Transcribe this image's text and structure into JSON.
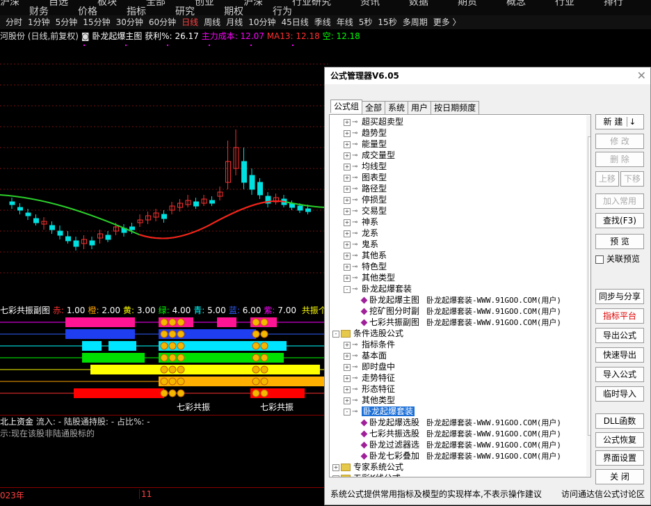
{
  "top_menu": [
    "沪深",
    "自选",
    "板块",
    "全部",
    "创业",
    "沪深",
    "行业研究",
    "资讯",
    "数据",
    "期货",
    "概念",
    "行业",
    "排行",
    "财务",
    "价格",
    "指标",
    "研究",
    "期权",
    "行为"
  ],
  "periods": [
    {
      "label": "分时",
      "active": false
    },
    {
      "label": "1分钟",
      "active": false
    },
    {
      "label": "5分钟",
      "active": false
    },
    {
      "label": "15分钟",
      "active": false
    },
    {
      "label": "30分钟",
      "active": false
    },
    {
      "label": "60分钟",
      "active": false
    },
    {
      "label": "日线",
      "active": true
    },
    {
      "label": "周线",
      "active": false
    },
    {
      "label": "月线",
      "active": false
    },
    {
      "label": "10分钟",
      "active": false
    },
    {
      "label": "45日线",
      "active": false
    },
    {
      "label": "季线",
      "active": false
    },
    {
      "label": "年线",
      "active": false
    },
    {
      "label": "5秒",
      "active": false
    },
    {
      "label": "15秒",
      "active": false
    },
    {
      "label": "多周期",
      "active": false
    },
    {
      "label": "更多 〉",
      "active": false
    }
  ],
  "info_bar": {
    "stock": "河股份 (日线,前复权)",
    "indicator": "卧龙起爆主图",
    "profit_label": "获利%:",
    "profit_value": "26.17",
    "cost_label": "主力成本:",
    "cost_value": "12.07",
    "ma_label": "MA13:",
    "ma_value": "12.18",
    "kong_label": "空:",
    "kong_value": "12.18"
  },
  "sub_chart": {
    "title": "七彩共振副图",
    "params": [
      {
        "name": "赤:",
        "value": "1.00",
        "color": "#ff3030"
      },
      {
        "name": "橙:",
        "value": "2.00",
        "color": "#ffa500"
      },
      {
        "name": "黄:",
        "value": "3.00",
        "color": "#ffff00"
      },
      {
        "name": "绿:",
        "value": "4.00",
        "color": "#00ff00"
      },
      {
        "name": "青:",
        "value": "5.00",
        "color": "#00ffff"
      },
      {
        "name": "蓝:",
        "value": "6.00",
        "color": "#3060ff"
      },
      {
        "name": "紫:",
        "value": "7.00",
        "color": "#ff00ff"
      }
    ],
    "tail": "共振个数",
    "labels": [
      "七彩共振",
      "七彩共振"
    ]
  },
  "north": {
    "prefix": "北上资金",
    "flow_label": "流入:",
    "flow_value": "-",
    "hold_label": "陆股通持股:",
    "hold_value": "-",
    "ratio_label": "占比%:",
    "ratio_value": "-",
    "message": "示:现在该股非陆通股标的"
  },
  "dates": [
    "023年",
    "11"
  ],
  "dialog": {
    "title": "公式管理器V6.05",
    "tabs": [
      "公式组",
      "全部",
      "系统",
      "用户",
      "按日期频度"
    ],
    "tree": [
      {
        "level": 1,
        "type": "key",
        "expander": "+",
        "label": "超买超卖型"
      },
      {
        "level": 1,
        "type": "key",
        "expander": "+",
        "label": "趋势型"
      },
      {
        "level": 1,
        "type": "key",
        "expander": "+",
        "label": "能量型"
      },
      {
        "level": 1,
        "type": "key",
        "expander": "+",
        "label": "成交量型"
      },
      {
        "level": 1,
        "type": "key",
        "expander": "+",
        "label": "均线型"
      },
      {
        "level": 1,
        "type": "key",
        "expander": "+",
        "label": "图表型"
      },
      {
        "level": 1,
        "type": "key",
        "expander": "+",
        "label": "路径型"
      },
      {
        "level": 1,
        "type": "key",
        "expander": "+",
        "label": "停损型"
      },
      {
        "level": 1,
        "type": "key",
        "expander": "+",
        "label": "交易型"
      },
      {
        "level": 1,
        "type": "key",
        "expander": "+",
        "label": "神系"
      },
      {
        "level": 1,
        "type": "key",
        "expander": "+",
        "label": "龙系"
      },
      {
        "level": 1,
        "type": "key",
        "expander": "+",
        "label": "鬼系"
      },
      {
        "level": 1,
        "type": "key",
        "expander": "+",
        "label": "其他系"
      },
      {
        "level": 1,
        "type": "key",
        "expander": "+",
        "label": "特色型"
      },
      {
        "level": 1,
        "type": "key",
        "expander": "+",
        "label": "其他类型"
      },
      {
        "level": 1,
        "type": "key",
        "expander": "-",
        "label": "卧龙起爆套装"
      },
      {
        "level": 2,
        "type": "item",
        "label": "卧龙起爆主图",
        "desc": "卧龙起爆套装-WWW.91GOO.COM(用户)"
      },
      {
        "level": 2,
        "type": "item",
        "label": "挖矿图分时副",
        "desc": "卧龙起爆套装-WWW.91GOO.COM(用户)"
      },
      {
        "level": 2,
        "type": "item",
        "label": "七彩共振副图",
        "desc": "卧龙起爆套装-WWW.91GOO.COM(用户)"
      },
      {
        "level": 0,
        "type": "folder",
        "expander": "-",
        "label": "条件选股公式"
      },
      {
        "level": 1,
        "type": "key",
        "expander": "+",
        "label": "指标条件"
      },
      {
        "level": 1,
        "type": "key",
        "expander": "+",
        "label": "基本面"
      },
      {
        "level": 1,
        "type": "key",
        "expander": "+",
        "label": "即时盘中"
      },
      {
        "level": 1,
        "type": "key",
        "expander": "+",
        "label": "走势特征"
      },
      {
        "level": 1,
        "type": "key",
        "expander": "+",
        "label": "形态特征"
      },
      {
        "level": 1,
        "type": "key",
        "expander": "+",
        "label": "其他类型"
      },
      {
        "level": 1,
        "type": "key",
        "expander": "-",
        "label": "卧龙起爆套装",
        "selected": true
      },
      {
        "level": 2,
        "type": "item",
        "label": "卧龙起爆选股",
        "desc": "卧龙起爆套装-WWW.91GOO.COM(用户)"
      },
      {
        "level": 2,
        "type": "item",
        "label": "七彩共振选股",
        "desc": "卧龙起爆套装-WWW.91GOO.COM(用户)"
      },
      {
        "level": 2,
        "type": "item",
        "label": "卧龙过滤器选",
        "desc": "卧龙起爆套装-WWW.91GOO.COM(用户)"
      },
      {
        "level": 2,
        "type": "item",
        "label": "卧龙七彩叠加",
        "desc": "卧龙起爆套装-WWW.91GOO.COM(用户)"
      },
      {
        "level": 0,
        "type": "folder",
        "expander": "+",
        "label": "专家系统公式"
      },
      {
        "level": 0,
        "type": "folder",
        "expander": "+",
        "label": "五彩K线公式"
      }
    ],
    "buttons": {
      "new": "新  建",
      "modify": "修  改",
      "delete": "删  除",
      "up": "上移",
      "down": "下移",
      "add_common": "加入常用",
      "find": "查找(F3)",
      "preview": "预  览",
      "link_preview": "关联预览",
      "sync": "同步与分享",
      "platform": "指标平台",
      "export": "导出公式",
      "quick_export": "快速导出",
      "import": "导入公式",
      "temp_import": "临时导入",
      "dll": "DLL函数",
      "restore": "公式恢复",
      "ui_settings": "界面设置",
      "close": "关  闭"
    },
    "footer_text": "系统公式提供常用指标及模型的实现样本,不表示操作建议",
    "footer_link": "访问通达信公式讨论区"
  },
  "colors": {
    "up": "#ff3030",
    "down": "#00e0e0",
    "ma_green": "#2bd12b",
    "ma_red": "#ff1a1a",
    "dialog_bg": "#f0f0f0",
    "select_blue": "#1c6fd6"
  }
}
